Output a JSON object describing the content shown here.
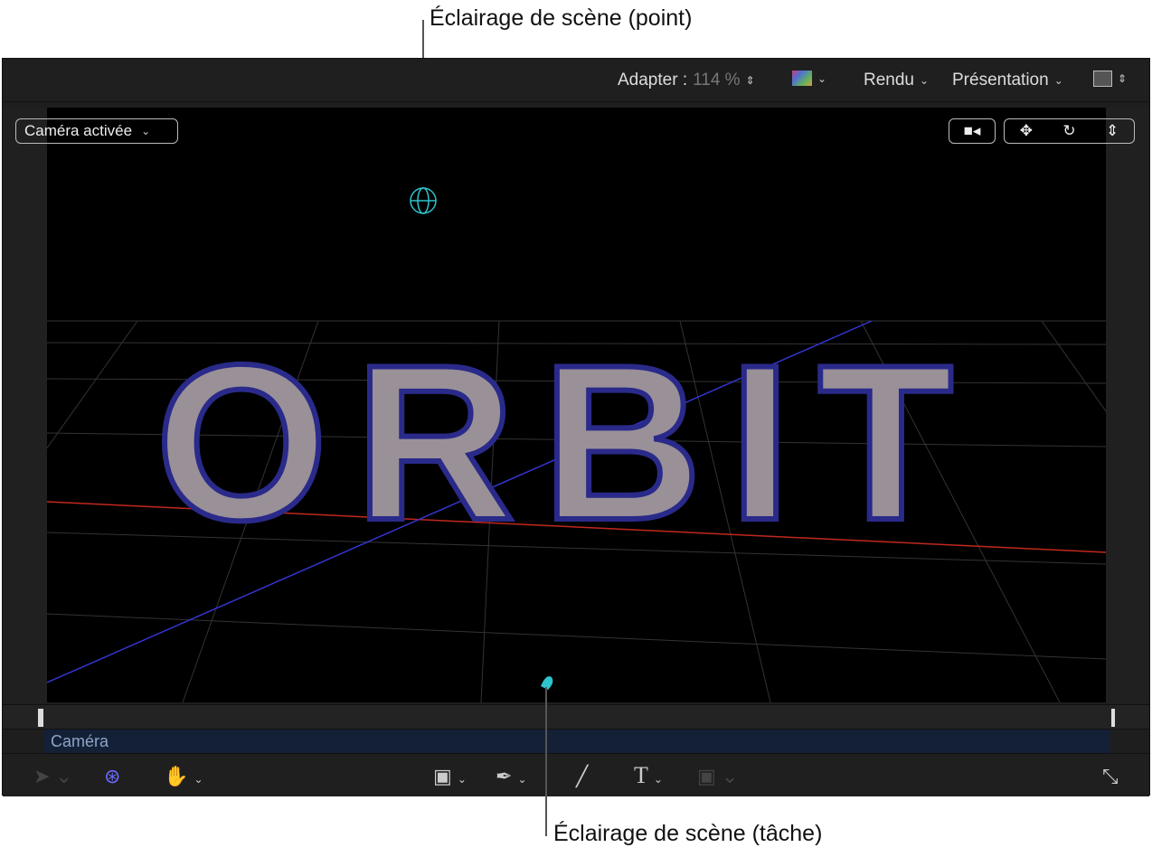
{
  "callouts": {
    "top": "Éclairage de scène (point)",
    "bottom": "Éclairage de scène (tâche)"
  },
  "toolbar": {
    "fit_label": "Adapter :",
    "zoom": "114 %",
    "render": "Rendu",
    "view": "Présentation"
  },
  "viewer": {
    "camera_menu": "Caméra activée",
    "scene_text": "ORBIT"
  },
  "timeline": {
    "track_label": "Caméra"
  },
  "colors": {
    "light_handle": "#2ec4cc",
    "orbit_tool": "#6b6bff",
    "track": "#132036"
  }
}
